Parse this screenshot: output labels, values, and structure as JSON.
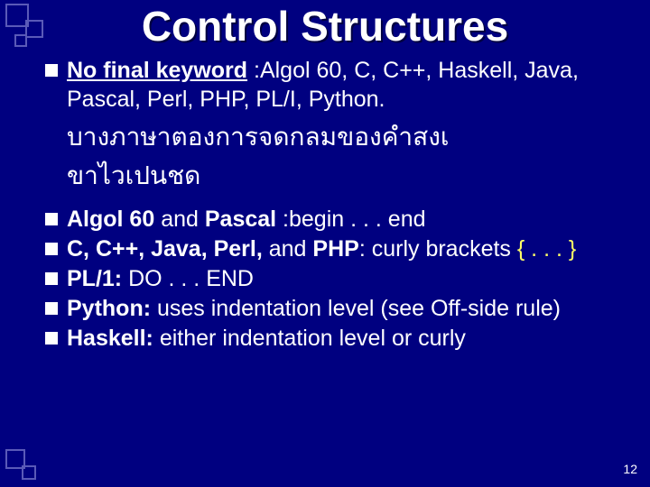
{
  "title": "Control Structures",
  "section1": {
    "lead_label": "No final keyword",
    "lead_sep": " :",
    "lead_rest": "Algol 60, C, C++, Haskell, Java, Pascal, Perl, PHP, PL/I, Python."
  },
  "thai": {
    "line1": "บางภาษาตองการจดกลมของคำสงเ",
    "line2": "ขาไวเปนชด"
  },
  "bullets": [
    {
      "strong": "Algol 60",
      "mid": " and ",
      "strong2": "Pascal ",
      "sep": " :",
      "rest": "begin . . . end"
    },
    {
      "strong": "C, C++, Java, Perl,",
      "mid": " and ",
      "strong2": "PHP",
      "sep": ": ",
      "rest_pre": "curly brackets ",
      "yellow": "{ . . . }"
    },
    {
      "strong": "PL/1:",
      "rest": " DO . . . END"
    },
    {
      "strong": "Python:",
      "rest": " uses indentation level (see Off-side rule)"
    },
    {
      "strong": "Haskell:",
      "rest": " either indentation level or curly"
    }
  ],
  "page_number": "12"
}
